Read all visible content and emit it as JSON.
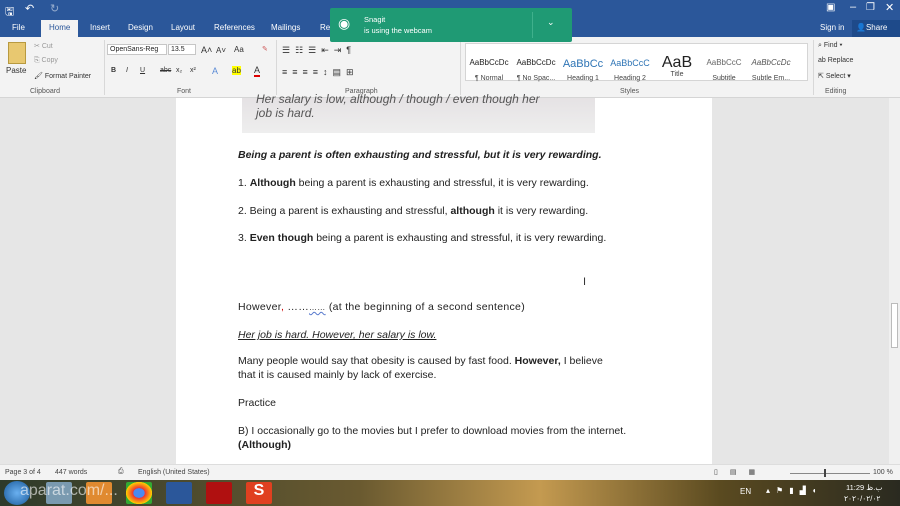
{
  "titlebar": {
    "save_icon": "save-icon",
    "undo_icon": "undo-icon",
    "redo_icon": "redo-icon"
  },
  "tabs": [
    "File",
    "Home",
    "Insert",
    "Design",
    "Layout",
    "References",
    "Mailings",
    "Re"
  ],
  "account": {
    "sign_in": "Sign in",
    "share": "Share"
  },
  "clipboard": {
    "paste": "Paste",
    "cut": "Cut",
    "copy": "Copy",
    "format_painter": "Format Painter",
    "label": "Clipboard"
  },
  "font": {
    "name": "OpenSans-Reg",
    "size": "13.5",
    "label": "Font",
    "bold": "B",
    "italic": "I",
    "underline": "U",
    "strike": "abc",
    "sub": "x₂",
    "sup": "x²",
    "case": "Aa"
  },
  "paragraph": {
    "label": "Paragraph"
  },
  "styles": {
    "label": "Styles",
    "items": [
      {
        "sample": "AaBbCcDc",
        "name": "¶ Normal"
      },
      {
        "sample": "AaBbCcDc",
        "name": "¶ No Spac..."
      },
      {
        "sample": "AaBbCc",
        "name": "Heading 1"
      },
      {
        "sample": "AaBbCcC",
        "name": "Heading 2"
      },
      {
        "sample": "AaB",
        "name": "Title"
      },
      {
        "sample": "AaBbCcC",
        "name": "Subtitle"
      },
      {
        "sample": "AaBbCcDc",
        "name": "Subtle Em..."
      }
    ]
  },
  "editing": {
    "find": "Find",
    "replace": "Replace",
    "select": "Select",
    "label": "Editing"
  },
  "snagit": {
    "title": "Snagit",
    "message": "is using the webcam"
  },
  "document": {
    "image_text_1": "Her salary is low, although / though / even though her",
    "image_text_2": "job is hard.",
    "heading": "Being a parent is often exhausting and stressful, but it is very rewarding.",
    "l1": {
      "num": "1. ",
      "bold": "Although",
      "rest": " being a parent is exhausting and stressful, it is very rewarding."
    },
    "l2": {
      "start": "2. Being a parent is exhausting and stressful, ",
      "bold": "although",
      "rest": " it is very rewarding."
    },
    "l3": {
      "num": "3. ",
      "bold": "Even though",
      "rest": " being a parent is exhausting and stressful, it is very rewarding."
    },
    "however": {
      "word": "However",
      "comma": ",",
      "dots": " ……",
      "dots2": "……",
      "rest": " (at the beginning of a second sentence)"
    },
    "example": "Her job is hard. However, her salary is low.",
    "obesity": {
      "start": "Many people would say that obesity is caused by fast food. ",
      "bold": "However,",
      "rest": " I believe that it is caused mainly by lack of exercise."
    },
    "practice": "Practice",
    "b": {
      "text": "B) I occasionally go to the movies but I prefer to download movies from the internet. ",
      "bold": "(Although)"
    }
  },
  "status": {
    "page": "Page 3 of 4",
    "words": "447 words",
    "language": "English (United States)",
    "zoom": "100 %"
  },
  "taskbar": {
    "lang": "EN",
    "time": "11:29 ب.ظ",
    "date": "۲۰۲۰/۰۲/۰۲",
    "watermark": "aparat.com/..."
  }
}
